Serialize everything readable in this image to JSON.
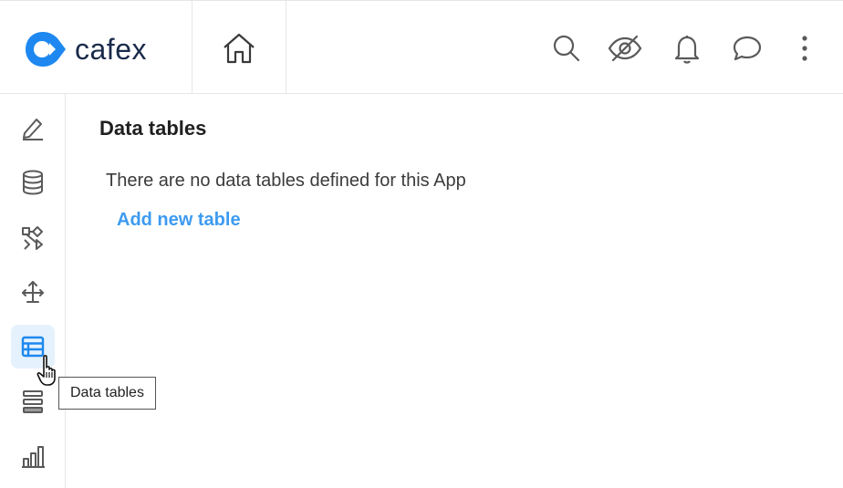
{
  "brand": {
    "name": "cafex",
    "color": "#1e88f0"
  },
  "header": {
    "icons": [
      "home-icon",
      "search-icon",
      "eye-off-icon",
      "bell-icon",
      "chat-icon",
      "more-vertical-icon"
    ]
  },
  "sidebar": {
    "items": [
      {
        "name": "edit",
        "icon": "pencil-icon"
      },
      {
        "name": "database",
        "icon": "database-icon"
      },
      {
        "name": "workflow",
        "icon": "workflow-icon"
      },
      {
        "name": "integrations",
        "icon": "connections-icon"
      },
      {
        "name": "data-tables",
        "icon": "table-icon",
        "active": true
      },
      {
        "name": "layouts",
        "icon": "stack-icon"
      },
      {
        "name": "analytics",
        "icon": "bar-chart-icon"
      }
    ],
    "tooltip": "Data tables"
  },
  "main": {
    "title": "Data tables",
    "empty_message": "There are no data tables defined for this App",
    "add_link": "Add new table"
  },
  "colors": {
    "accent": "#3d9bf0",
    "active_bg": "#e5f2fd",
    "icon": "#5a5a5a"
  }
}
